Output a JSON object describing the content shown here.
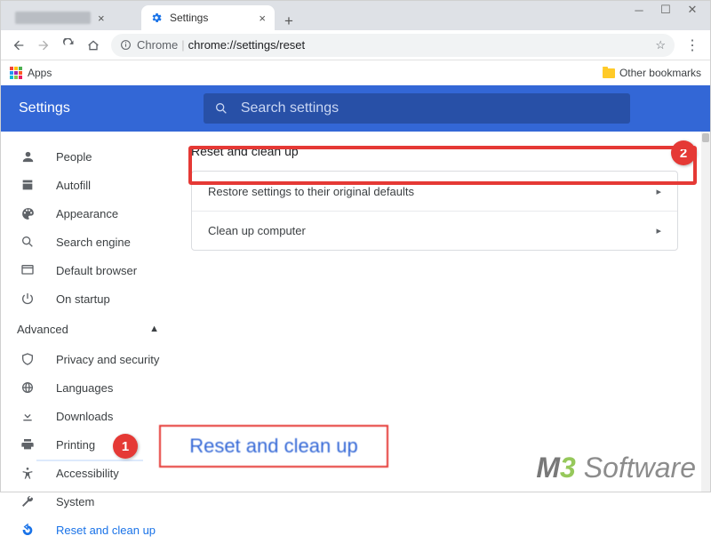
{
  "window": {
    "title_tab1": "",
    "title_tab2": "Settings"
  },
  "toolbar": {
    "chrome_label": "Chrome",
    "url": "chrome://settings/reset"
  },
  "bookmarks": {
    "apps_label": "Apps",
    "other_label": "Other bookmarks"
  },
  "header": {
    "title": "Settings",
    "search_placeholder": "Search settings"
  },
  "sidebar": {
    "basic": [
      {
        "icon": "person",
        "label": "People"
      },
      {
        "icon": "autofill",
        "label": "Autofill"
      },
      {
        "icon": "appearance",
        "label": "Appearance"
      },
      {
        "icon": "search",
        "label": "Search engine"
      },
      {
        "icon": "browser",
        "label": "Default browser"
      },
      {
        "icon": "power",
        "label": "On startup"
      }
    ],
    "advanced_label": "Advanced",
    "advanced": [
      {
        "icon": "shield",
        "label": "Privacy and security"
      },
      {
        "icon": "globe",
        "label": "Languages"
      },
      {
        "icon": "download",
        "label": "Downloads"
      },
      {
        "icon": "print",
        "label": "Printing"
      },
      {
        "icon": "a11y",
        "label": "Accessibility"
      },
      {
        "icon": "wrench",
        "label": "System"
      },
      {
        "icon": "restore",
        "label": "Reset and clean up"
      }
    ]
  },
  "main": {
    "heading": "Reset and clean up",
    "row1": "Restore settings to their original defaults",
    "row2": "Clean up computer"
  },
  "annotations": {
    "b1": "1",
    "b2": "2",
    "callout": "Reset and clean up"
  },
  "watermark": {
    "m3": "M3",
    "sw": "Software"
  }
}
